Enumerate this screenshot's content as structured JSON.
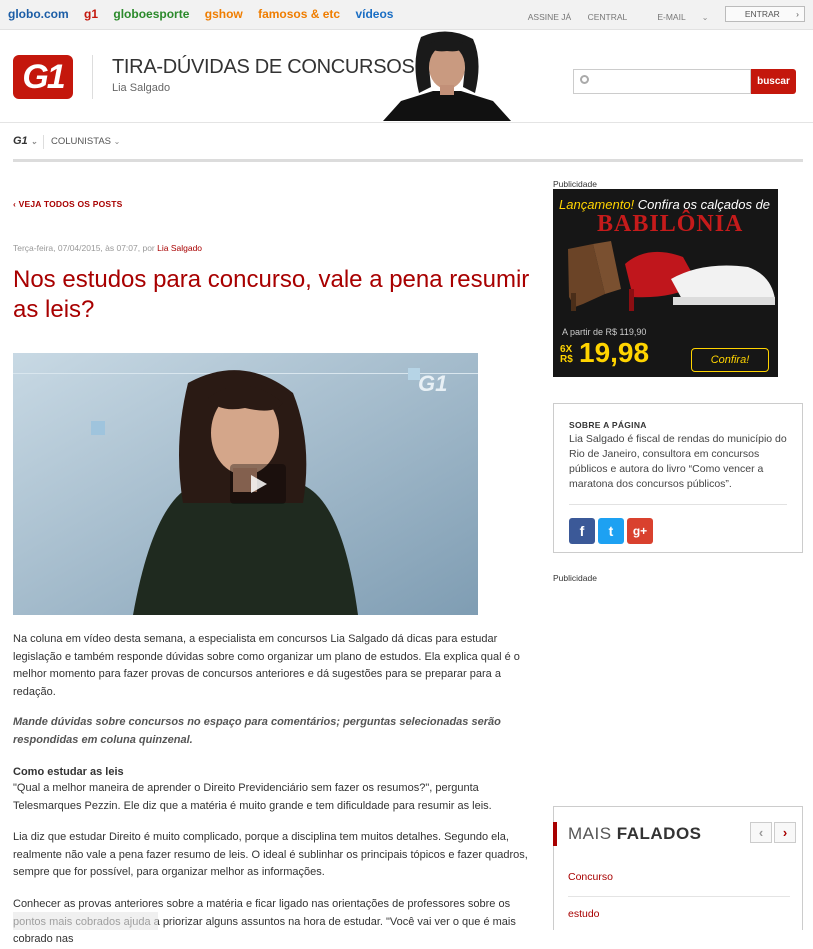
{
  "globo_bar": {
    "links": [
      "globo.com",
      "g1",
      "globoesporte",
      "gshow",
      "famosos & etc",
      "vídeos"
    ],
    "right_links": [
      "ASSINE JÁ",
      "CENTRAL",
      "E-MAIL",
      "ENTRAR"
    ]
  },
  "header": {
    "logo_text": "G1",
    "blog_title": "TIRA-DÚVIDAS DE CONCURSOS",
    "author": "Lia Salgado",
    "search_placeholder": "",
    "search_button": "buscar"
  },
  "nav": {
    "g1_label": "G1",
    "colunistas_label": "COLUNISTAS"
  },
  "article": {
    "back_link": "VEJA TODOS OS POSTS",
    "meta_date": "Terça-feira, 07/04/2015, às 07:07, por",
    "meta_author": "Lia Salgado",
    "title": "Nos estudos para concurso, vale a pena resumir as leis?",
    "paragraph_1": "Na coluna em vídeo desta semana, a especialista em concursos Lia Salgado dá dicas para estudar legislação e também responde dúvidas sobre como organizar um plano de estudos. Ela explica qual é o melhor momento para fazer provas de concursos anteriores e dá sugestões para se preparar para a redação.",
    "paragraph_2": "Mande dúvidas sobre concursos no espaço para comentários; perguntas selecionadas serão respondidas em coluna quinzenal.",
    "subheading": "Como estudar as leis",
    "paragraph_3": "\"Qual a melhor maneira de aprender o Direito Previdenciário sem fazer os resumos?\", pergunta Telesmarques Pezzin. Ele diz que a matéria é muito grande e tem dificuldade para resumir as leis.",
    "paragraph_4": "Lia diz que estudar Direito é muito complicado, porque a disciplina tem muitos detalhes. Segundo ela, realmente não vale a pena fazer resumo de leis. O ideal é sublinhar os principais tópicos e fazer quadros, sempre que for possível, para organizar melhor as informações.",
    "paragraph_5": "Conhecer as provas anteriores sobre a matéria e ficar ligado nas orientações de professores sobre os pontos mais cobrados ajuda a priorizar alguns assuntos na hora de estudar. \"Você vai ver o que é mais cobrado nas"
  },
  "sidebar": {
    "publicidade_1": "Publicidade",
    "publicidade_2": "Publicidade",
    "ad": {
      "headline_highlight": "Lançamento!",
      "headline_rest": " Confira os calçados de",
      "brand": "BABILÔNIA",
      "from_price": "A partir de R$ 119,90",
      "installments": "6X R$",
      "price": "19,98",
      "cta": "Confira!"
    },
    "about": {
      "heading": "SOBRE A PÁGINA",
      "text": "Lia Salgado é fiscal de rendas do município do Rio de Janeiro, consultora em concursos públicos e autora do livro “Como vencer a maratona dos concursos públicos”.",
      "social": [
        "f",
        "t",
        "g+"
      ]
    },
    "mais_falados": {
      "title_light": "MAIS",
      "title_bold": "FALADOS",
      "items": [
        "Concurso",
        "estudo"
      ]
    }
  },
  "colors": {
    "brand_red": "#c4170c",
    "title_red": "#a80000"
  }
}
